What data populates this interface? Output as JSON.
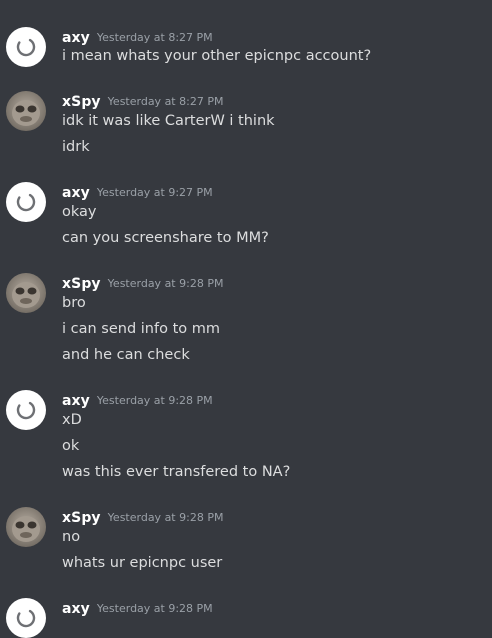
{
  "colors": {
    "background": "#36393f",
    "username": "#ffffff",
    "timestamp": "#9aa0a7",
    "message": "#dcddde"
  },
  "groups": [
    {
      "username": "axy",
      "timestamp": "Yesterday at 8:27 PM",
      "avatar_icon": "loading-spinner-icon",
      "messages": [
        "i mean whats your other epicnpc account?"
      ]
    },
    {
      "username": "xSpy",
      "timestamp": "Yesterday at 8:27 PM",
      "avatar_icon": "user-photo-icon",
      "messages": [
        "idk it was like CarterW  i think",
        "idrk"
      ]
    },
    {
      "username": "axy",
      "timestamp": "Yesterday at 9:27 PM",
      "avatar_icon": "loading-spinner-icon",
      "messages": [
        "okay",
        "can you screenshare to MM?"
      ]
    },
    {
      "username": "xSpy",
      "timestamp": "Yesterday at 9:28 PM",
      "avatar_icon": "user-photo-icon",
      "messages": [
        "bro",
        "i can send info to mm",
        "and he can check"
      ]
    },
    {
      "username": "axy",
      "timestamp": "Yesterday at 9:28 PM",
      "avatar_icon": "loading-spinner-icon",
      "messages": [
        "xD",
        "ok",
        "was this ever transfered to NA?"
      ]
    },
    {
      "username": "xSpy",
      "timestamp": "Yesterday at 9:28 PM",
      "avatar_icon": "user-photo-icon",
      "messages": [
        "no",
        "whats ur epicnpc user"
      ]
    },
    {
      "username": "axy",
      "timestamp": "Yesterday at 9:28 PM",
      "avatar_icon": "loading-spinner-icon",
      "messages": []
    }
  ]
}
